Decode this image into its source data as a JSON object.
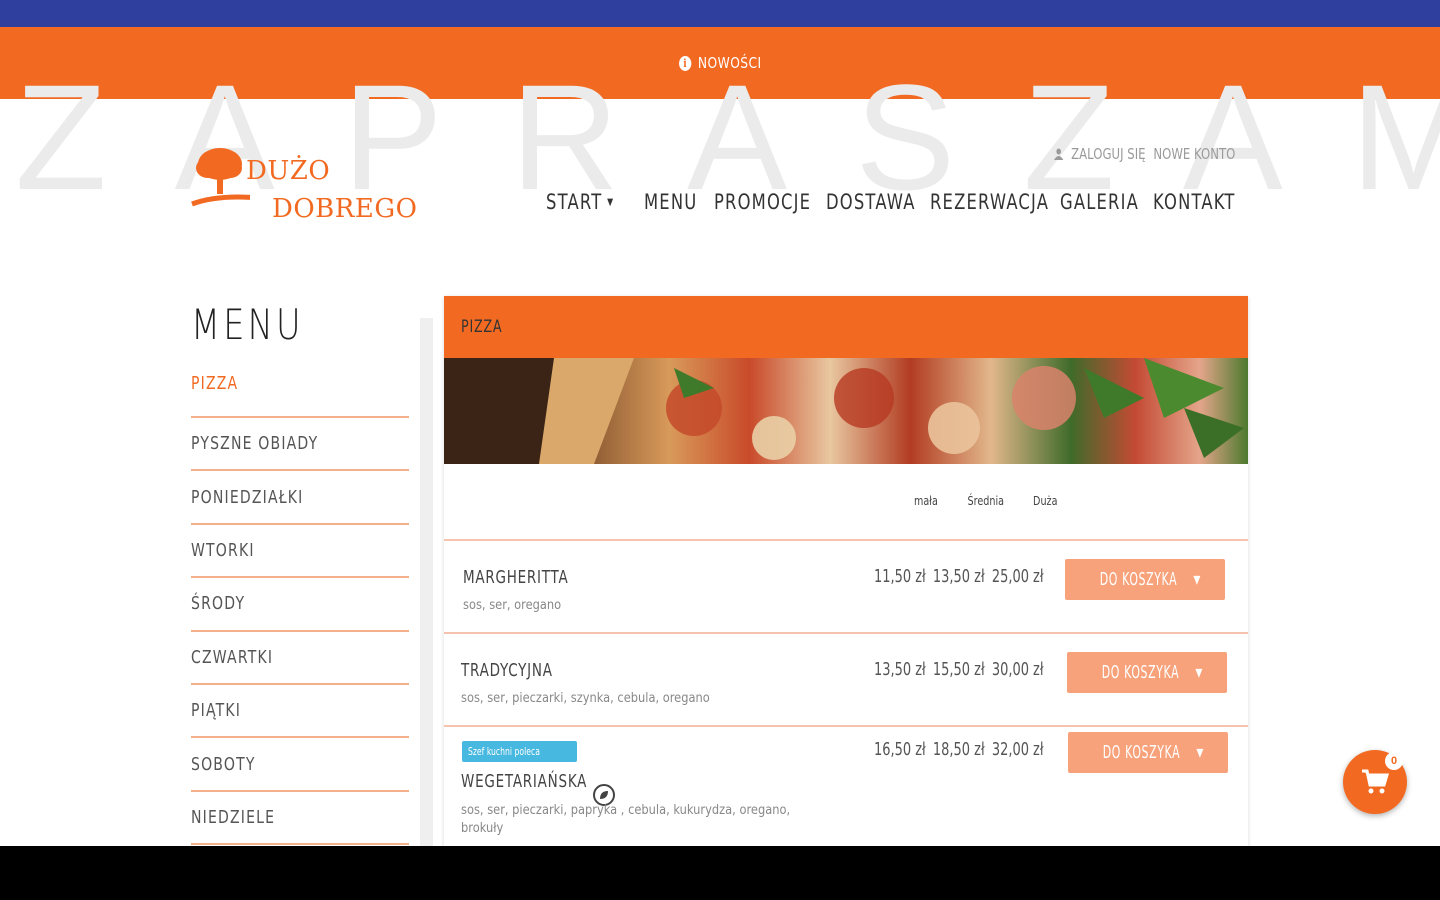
{
  "announcement": {
    "text": "NOWOŚCI",
    "icon": "info-icon"
  },
  "background_word": "ZAPRASZAMY",
  "logo": {
    "line1": "DUŻO",
    "line2": "DOBREGO",
    "color": "#f26a22"
  },
  "account": {
    "login_label": "ZALOGUJ SIĘ",
    "register_label": "NOWE KONTO"
  },
  "nav": {
    "items": [
      {
        "label": "START",
        "dropdown": true
      },
      {
        "label": "MENU"
      },
      {
        "label": "PROMOCJE"
      },
      {
        "label": "DOSTAWA"
      },
      {
        "label": "REZERWACJA"
      },
      {
        "label": "GALERIA"
      },
      {
        "label": "KONTAKT"
      }
    ]
  },
  "sidebar": {
    "title": "MENU",
    "items": [
      {
        "label": "PIZZA",
        "active": true
      },
      {
        "label": "PYSZNE OBIADY"
      },
      {
        "label": "PONIEDZIAŁKI"
      },
      {
        "label": "WTORKI"
      },
      {
        "label": "ŚRODY"
      },
      {
        "label": "CZWARTKI"
      },
      {
        "label": "PIĄTKI"
      },
      {
        "label": "SOBOTY"
      },
      {
        "label": "NIEDZIELE"
      }
    ]
  },
  "panel": {
    "category": "PIZZA",
    "sizes": [
      "mała",
      "Średnia",
      "Duża"
    ],
    "items": [
      {
        "name": "MARGHERITTA",
        "description": "sos, ser, oregano",
        "prices": [
          "11,50 zł",
          "13,50 zł",
          "25,00 zł"
        ],
        "button": "DO KOSZYKA"
      },
      {
        "name": "TRADYCYJNA",
        "description": "sos, ser, pieczarki, szynka, cebula, oregano",
        "prices": [
          "13,50 zł",
          "15,50 zł",
          "30,00 zł"
        ],
        "button": "DO KOSZYKA"
      },
      {
        "name": "WEGETARIAŃSKA",
        "badge": "Szef kuchni poleca",
        "description": "sos, ser, pieczarki, papryka , cebula, kukurydza, oregano,",
        "description2": "brokuły",
        "prices": [
          "16,50 zł",
          "18,50 zł",
          "32,00 zł"
        ],
        "button": "DO KOSZYKA",
        "icon": "vegetarian-icon"
      }
    ]
  },
  "cart": {
    "count": "0",
    "icon": "cart-icon"
  },
  "colors": {
    "accent": "#f26a22",
    "topbar": "#2f3f9e",
    "button": "#f7a27a",
    "badge": "#47b8e0"
  }
}
